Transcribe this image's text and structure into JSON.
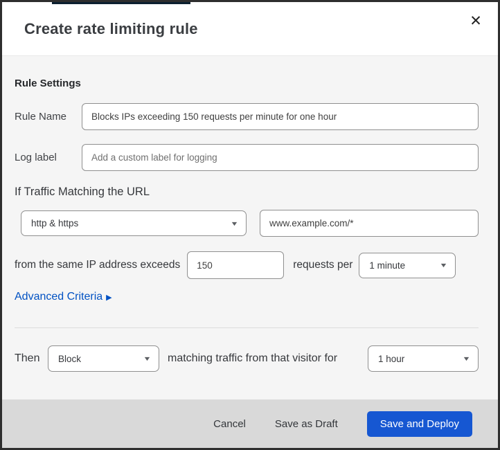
{
  "dialog": {
    "title": "Create rate limiting rule"
  },
  "icons": {
    "close": "✕",
    "caret_down": "▼",
    "caret_right": "▶"
  },
  "rule_settings": {
    "heading": "Rule Settings",
    "rule_name": {
      "label": "Rule Name",
      "value": "Blocks IPs exceeding 150 requests per minute for one hour"
    },
    "log_label": {
      "label": "Log label",
      "placeholder": "Add a custom label for logging"
    }
  },
  "match": {
    "intro": "If Traffic Matching the URL",
    "scheme_select": {
      "value": "http & https"
    },
    "url_input": {
      "value": "www.example.com/*"
    },
    "threshold_prefix": "from the same IP address exceeds",
    "threshold_value": "150",
    "threshold_suffix": "requests per",
    "period_select": {
      "value": "1 minute"
    },
    "advanced_link": "Advanced Criteria"
  },
  "action": {
    "then_label": "Then",
    "action_select": {
      "value": "Block"
    },
    "middle_text": "matching traffic from that visitor for",
    "duration_select": {
      "value": "1 hour"
    }
  },
  "footer": {
    "cancel_label": "Cancel",
    "save_draft_label": "Save as Draft",
    "save_deploy_label": "Save and Deploy"
  },
  "colors": {
    "primary_button": "#1657d2",
    "link": "#0051c3",
    "footer_background": "#d9d9d9",
    "body_background": "#f5f5f5"
  }
}
